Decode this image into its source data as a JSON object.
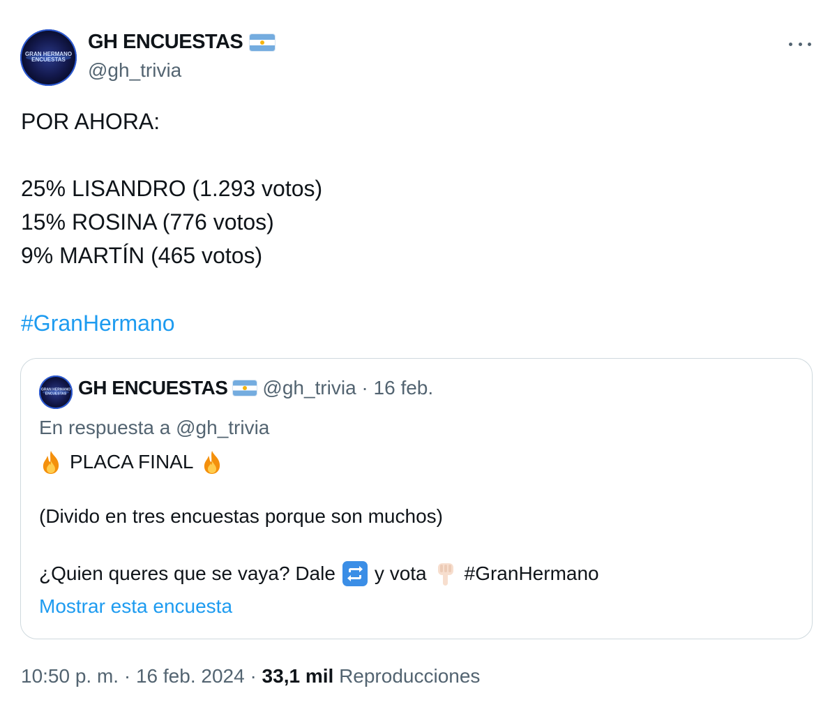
{
  "author": {
    "display_name": "GH ENCUESTAS",
    "handle": "@gh_trivia",
    "avatar_text_line1": "GRAN HERMANO",
    "avatar_text_line2": "ENCUESTAS"
  },
  "tweet": {
    "lines": [
      "POR AHORA:",
      "25% LISANDRO (1.293 votos)",
      "15% ROSINA (776 votos)",
      "9% MARTÍN (465 votos)"
    ],
    "hashtag": "#GranHermano"
  },
  "quoted": {
    "display_name": "GH ENCUESTAS",
    "handle_date": "@gh_trivia · 16 feb.",
    "reply_to": "En respuesta a @gh_trivia",
    "title": "PLACA FINAL",
    "note": "(Divido en tres encuestas porque son muchos)",
    "question_pre": "¿Quien queres que se vaya? Dale",
    "question_mid": "y vota",
    "question_hashtag": "#GranHermano",
    "show_poll": "Mostrar esta encuesta"
  },
  "footer": {
    "time_date": "10:50 p. m. · 16 feb. 2024 ·",
    "views_count": "33,1 mil",
    "views_label": "Reproducciones"
  },
  "colors": {
    "link": "#1d9bf0",
    "secondary_text": "#536471",
    "primary_text": "#0f1419",
    "border": "#cfd9de"
  },
  "icons": {
    "more": "more-horizontal-icon",
    "flag": "argentina-flag-icon",
    "fire": "fire-icon",
    "repeat": "repeat-icon",
    "point": "backhand-index-pointing-down-icon"
  }
}
